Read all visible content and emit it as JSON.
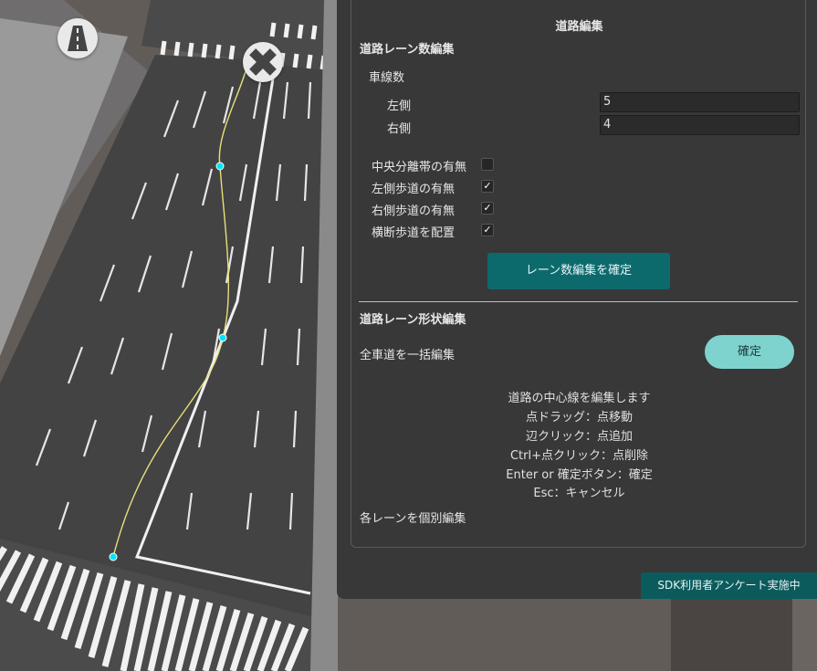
{
  "panel": {
    "title": "道路編集",
    "lane_count_section": {
      "heading": "道路レーン数編集",
      "lane_count_label": "車線数",
      "left_label": "左側",
      "left_value": "5",
      "right_label": "右側",
      "right_value": "4",
      "options": [
        {
          "label": "中央分離帯の有無",
          "checked": false,
          "mark": ""
        },
        {
          "label": "左側歩道の有無",
          "checked": true,
          "mark": "✓"
        },
        {
          "label": "右側歩道の有無",
          "checked": true,
          "mark": "✓"
        },
        {
          "label": "横断歩道を配置",
          "checked": true,
          "mark": "✓"
        }
      ],
      "confirm_label": "レーン数編集を確定"
    },
    "shape_section": {
      "heading": "道路レーン形状編集",
      "bulk_edit_label": "全車道を一括編集",
      "confirm_label": "確定",
      "help_lines": [
        "道路の中心線を編集します",
        "点ドラッグ：点移動",
        "辺クリック：点追加",
        "Ctrl+点クリック：点削除",
        "Enter or 確定ボタン：確定",
        "Esc：キャンセル"
      ],
      "individual_edit_label": "各レーンを個別編集"
    }
  },
  "survey_banner": "SDK利用者アンケート実施中",
  "map": {
    "road_icon": "road-icon",
    "intersection_icon": "intersection-icon",
    "control_point_color": "#00e5ff",
    "spline_color": "#e8e07a"
  }
}
